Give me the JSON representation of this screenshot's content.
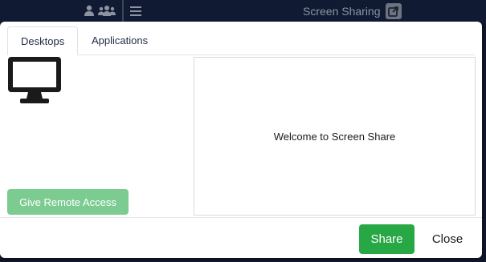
{
  "topbar": {
    "title": "Screen Sharing",
    "icons": [
      "user-icon",
      "users-icon",
      "menu-icon",
      "share-screen-icon"
    ]
  },
  "modal": {
    "tabs": [
      {
        "label": "Desktops",
        "active": true
      },
      {
        "label": "Applications",
        "active": false
      }
    ],
    "preview_text": "Welcome to Screen Share",
    "remote_access_label": "Give Remote Access",
    "share_label": "Share",
    "close_label": "Close",
    "monitor_icon": "desktop-monitor-icon"
  },
  "colors": {
    "topbar_bg": "#101a33",
    "share_button": "#28a745",
    "remote_button": "#7ccc92"
  }
}
